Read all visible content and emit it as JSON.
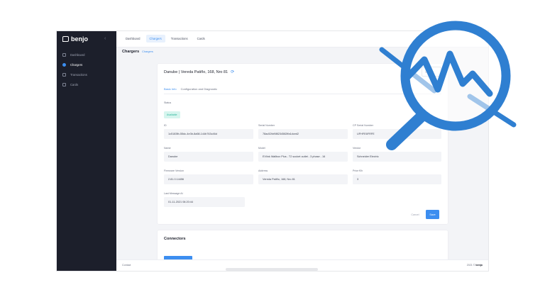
{
  "brand": {
    "name": "benjo"
  },
  "sidebar": {
    "items": [
      {
        "label": "Dashboard",
        "icon": "chart-icon"
      },
      {
        "label": "Chargers",
        "icon": "charger-icon",
        "active": true
      },
      {
        "label": "Transactions",
        "icon": "list-icon"
      },
      {
        "label": "Cards",
        "icon": "card-icon"
      }
    ]
  },
  "topbar": {
    "tabs": [
      {
        "label": "Dashboard"
      },
      {
        "label": "Chargers",
        "active": true
      },
      {
        "label": "Transactions"
      },
      {
        "label": "Cards"
      }
    ]
  },
  "breadcrumb": {
    "title": "Chargers",
    "sub": "Chargers"
  },
  "charger": {
    "title": "Danube | Vereda Patiño, 168, Nro 81",
    "edit_label": "Edit",
    "refresh_label": "Re",
    "tabs": [
      {
        "label": "Basic Info",
        "active": true
      },
      {
        "label": "Configuration and Diagnostic"
      }
    ],
    "status": {
      "label": "Status",
      "value": "Available",
      "color": "#2bb59b"
    },
    "fields": {
      "id": {
        "label": "ID",
        "value": "1c5183fb-55dc-4e3b-8a58-144b763c46d"
      },
      "serial": {
        "label": "Serial Number",
        "value": "78ac52fcf6f8234582ffa1dced2"
      },
      "cp_serial": {
        "label": "CP Serial Number",
        "value": "UFHFE6FRFE"
      },
      "name": {
        "label": "Name",
        "value": "Danube"
      },
      "model": {
        "label": "Model",
        "value": "EVlink Wallbox Plus - T2 socket outlet - 3 phase - 16"
      },
      "vendor": {
        "label": "Vendor",
        "value": "Schneider Electric"
      },
      "firmware": {
        "label": "Firmware Version",
        "value": "2.81.0.14456"
      },
      "address": {
        "label": "Address",
        "value": "Vereda Patiño, 168, Nro 81"
      },
      "price": {
        "label": "Price €/h",
        "value": "3"
      },
      "last_message": {
        "label": "Last Message At",
        "value": "01-11-2021 06:20:44"
      }
    },
    "cancel_label": "Cancel",
    "save_label": "Save"
  },
  "connectors": {
    "title": "Connectors"
  },
  "footer": {
    "left": "Contact",
    "right_prefix": "2021 ©",
    "right_brand": "benjo"
  },
  "colors": {
    "accent": "#3c8ef0",
    "sidebar": "#1c1f2b",
    "magnifier": "#2f7fd1"
  }
}
